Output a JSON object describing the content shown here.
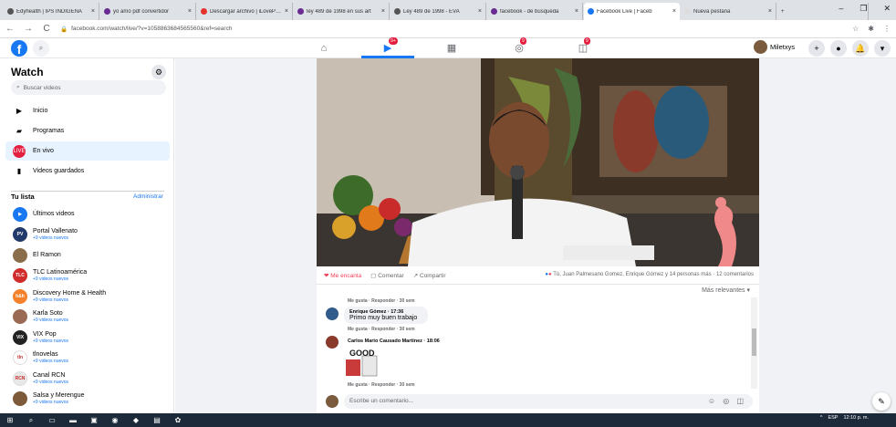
{
  "browser": {
    "tabs": [
      {
        "title": "Edyhealth | IPS INDIGENA",
        "color": "#555555"
      },
      {
        "title": "yo amo pdf convertidor",
        "color": "#6a2c91"
      },
      {
        "title": "Descargar archivo | iLovePDF",
        "color": "#e5322d"
      },
      {
        "title": "ley 489 de 1998 en sus art",
        "color": "#6a2c91"
      },
      {
        "title": "Ley 489 de 1998 - EVA",
        "color": "#555555"
      },
      {
        "title": "facebook - de búsqueda",
        "color": "#6a2c91"
      },
      {
        "title": "Facebook Live | Faceb",
        "color": "#1877f2",
        "active": true
      },
      {
        "title": "Nueva pestaña",
        "color": "#dddddd"
      }
    ],
    "close_glyph": "×",
    "new_tab_glyph": "+",
    "window_controls": [
      "–",
      "❐",
      "✕"
    ],
    "url": "facebook.com/watch/live/?v=1058863684565560&ref=search",
    "nav": [
      "←",
      "→",
      "C"
    ]
  },
  "fb": {
    "logo": "f",
    "user_name": "Miletxys",
    "top_icons": [
      "⌂",
      "▶",
      "▦",
      "◎",
      "◫"
    ],
    "badges": [
      "9+",
      "",
      "9",
      "9"
    ],
    "right_buttons": [
      "+",
      "●",
      "🔔",
      "▾"
    ]
  },
  "sidebar": {
    "title": "Watch",
    "search_placeholder": "Buscar videos",
    "items": [
      {
        "label": "Inicio",
        "icon": "▶"
      },
      {
        "label": "Programas",
        "icon": "▰"
      },
      {
        "label": "En vivo",
        "icon": "LIVE",
        "active": true
      },
      {
        "label": "Videos guardados",
        "icon": "▮"
      }
    ],
    "list_title": "Tu lista",
    "admin": "Administrar",
    "list": [
      {
        "name": "Últimos videos",
        "sub": "",
        "color": "#1877f2",
        "abbr": "▶"
      },
      {
        "name": "Portal Vallenato",
        "sub": "+9 videos nuevos",
        "color": "#223a6b",
        "abbr": "PV"
      },
      {
        "name": "El Ramon",
        "sub": "",
        "color": "#8a6d4b",
        "abbr": ""
      },
      {
        "name": "TLC Latinoamérica",
        "sub": "+9 videos nuevos",
        "color": "#d12c2c",
        "abbr": "TLC"
      },
      {
        "name": "Discovery Home & Health",
        "sub": "+9 videos nuevos",
        "color": "#f5812b",
        "abbr": "h&h"
      },
      {
        "name": "Karla Soto",
        "sub": "+9 videos nuevos",
        "color": "#9a6a54",
        "abbr": ""
      },
      {
        "name": "VIX Pop",
        "sub": "+9 videos nuevos",
        "color": "#222222",
        "abbr": "VIX"
      },
      {
        "name": "tlnovelas",
        "sub": "+9 videos nuevos",
        "color": "#ffffff",
        "abbr": "tln"
      },
      {
        "name": "Canal RCN",
        "sub": "+9 videos nuevos",
        "color": "#e8e8e8",
        "abbr": "RCN"
      },
      {
        "name": "Salsa y Merengue",
        "sub": "+9 videos nuevos",
        "color": "#7d5a3a",
        "abbr": ""
      }
    ]
  },
  "post": {
    "love": "Me encanta",
    "comment": "Comentar",
    "share": "Compartir",
    "reactions_text": "Tú, Juan Palmesano Gomez, Enrique Gómez y 14 personas más · 12 comentarios",
    "sort": "Más relevantes ▾"
  },
  "comments": [
    {
      "meta": "Me gusta · Responder · 30 sem"
    },
    {
      "name": "Enrique Gómez · 17:36",
      "text": "Primo muy buen trabajo",
      "meta": "Me gusta · Responder · 30 sem"
    },
    {
      "name": "Carlos Mario Causado Martinez · 18:06",
      "text": "",
      "meta": "Me gusta · Responder · 30 sem",
      "sticker": "GOOD"
    }
  ],
  "writer": {
    "placeholder": "Escribe un comentario...",
    "icons": "☺ ◎ ◫"
  },
  "fab": "✎",
  "taskbar": {
    "icons": [
      "⊞",
      "⌕",
      "▭",
      "▬",
      "▣",
      "◉",
      "◆",
      "▤",
      "✿"
    ],
    "tray": [
      "^",
      "ESP",
      "12:10 p. m."
    ]
  }
}
